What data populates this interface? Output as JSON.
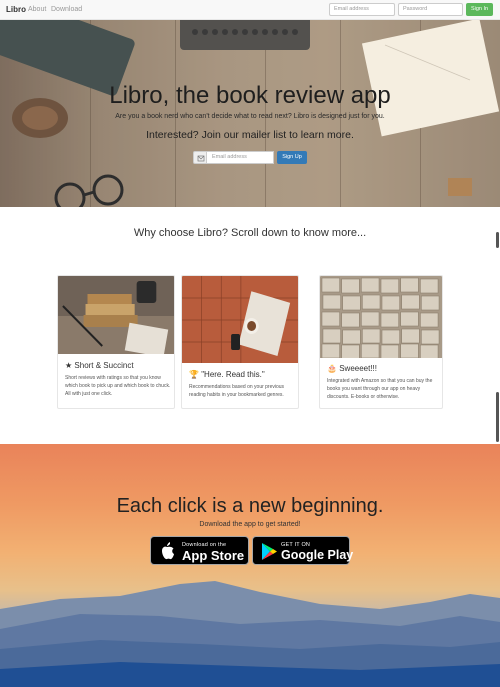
{
  "navbar": {
    "brand": "Libro",
    "links": [
      "About",
      "Download"
    ],
    "email_placeholder": "Email address",
    "password_placeholder": "Password",
    "signin_label": "Sign In"
  },
  "hero": {
    "title": "Libro, the book review app",
    "subtitle": "Are you a book nerd who can't decide what to read next? Libro is designed just for you.",
    "cta": "Interested? Join our mailer list to learn more.",
    "email_placeholder": "Email address",
    "signup_label": "Sign Up"
  },
  "why": {
    "title": "Why choose Libro? Scroll down to know more..."
  },
  "cards": [
    {
      "icon": "star-icon",
      "title": "Short & Succinct",
      "text": "Short reviews with ratings so that you know which book to pick up and which book to chuck. All with just one click."
    },
    {
      "icon": "trophy-icon",
      "title": "\"Here. Read this.\"",
      "text": "Recommendations based on your previous reading habits in your bookmarked genres."
    },
    {
      "icon": "cake-icon",
      "title": "Sweeeet!!!",
      "text": "Integrated with Amazon so that you can buy the books you want through our app on heavy discounts. E-books or otherwise."
    }
  ],
  "download": {
    "title": "Each click is a new beginning.",
    "subtitle": "Download the app to get started!",
    "appstore_small": "Download on the",
    "appstore_big": "App Store",
    "googleplay_small": "GET IT ON",
    "googleplay_big": "Google Play"
  },
  "colors": {
    "signin": "#5cb85c",
    "signup": "#337ab7",
    "navbar_bg": "#f8f8f8"
  }
}
